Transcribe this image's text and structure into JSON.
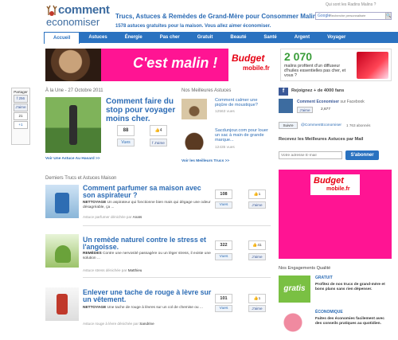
{
  "header": {
    "logo_line1": "comment",
    "logo_line2": "economiser",
    "tagline": "Trucs, Astuces & Remèdes de Grand-Mère pour Consommer Malin.",
    "subtagline": "1578 astuces gratuites pour la maison. Vous allez aimer économiser.",
    "top_link": "Qui sont les Radins Malins ?",
    "search_brand": "Google",
    "search_placeholder": "Recherche personnalisée",
    "search_button": "🔍"
  },
  "nav": {
    "items": [
      "Accueil",
      "Astuces",
      "Énergie",
      "Pas cher",
      "Gratuit",
      "Beauté",
      "Santé",
      "Argent",
      "Voyager"
    ]
  },
  "banner": {
    "slogan": "C'est malin !",
    "brand1": "Budget",
    "brand2": "mobile.fr"
  },
  "ad_right": {
    "number": "2 070",
    "text": "malins profitent d'un diffuseur d'huiles essentielles pas cher, et vous ?"
  },
  "share": {
    "label": "Partager",
    "fb_count": "256",
    "fb_label": "J'aime",
    "count2": "21",
    "plus": "+1"
  },
  "une": {
    "heading": "À la Une - 27 Octobre 2011",
    "title": "Comment faire du stop pour voyager moins cher.",
    "count": "88",
    "vues": "Vues",
    "like": "4",
    "like_fb": "J'aime",
    "random_link": "Voir Une Astuce Au Hasard >>"
  },
  "best": {
    "heading": "Nos Meilleures Astuces",
    "items": [
      {
        "title": "Comment calmer une piqûre de moustique?",
        "views": "12563 vues"
      },
      {
        "title": "Sacdunjour.com pour louer un sac à main de grande marque...",
        "views": "12435 vues"
      }
    ],
    "link": "Voir les Meilleurs Trucs >>"
  },
  "derniers": {
    "heading": "Derniers Trucs et Astuces Maison",
    "articles": [
      {
        "title": "Comment parfumer sa maison avec son aspirateur ?",
        "desc_prefix": "NETTOYAGE",
        "desc": "Un aspirateur qui fonctionne bien mais qui dégage une odeur désagréable, ça ...",
        "author_prefix": "Astuce parfumer dénichée par",
        "author": "Anaïs",
        "count": "108",
        "likes": "1"
      },
      {
        "title": "Un remède naturel contre le stress et l'angoisse.",
        "desc_prefix": "REMÈDES",
        "desc": "Contre une nervosité passagère ou un léger stress, il existe une solution ...",
        "author_prefix": "Astuce stress dénichée par",
        "author": "Matthieu",
        "count": "322",
        "likes": "41"
      },
      {
        "title": "Enlever une tache de rouge à lèvre sur un vêtement.",
        "desc_prefix": "NETTOYAGE",
        "desc": "Une tache de rouge à lèvres sur un col de chemise ou ...",
        "author_prefix": "Astuce rouge à lèvre dénichée par",
        "author": "Sandrine",
        "count": "101",
        "likes": "1"
      }
    ],
    "vues": "Vues",
    "like_fb": "J'aime"
  },
  "right": {
    "fb_heading": "Rejoignez + de 4000 fans",
    "fb_name": "Comment Economiser",
    "fb_on": "sur Facebook",
    "fb_like": "J'aime",
    "fb_count": "2,677",
    "tw_follow": "Suivre",
    "tw_handle": "@CommentEconomiser",
    "tw_count": "1 763 abonnés",
    "newsletter_heading": "Recevez les Meilleures Astuces par Mail",
    "newsletter_placeholder": "Votre adresse E-mail",
    "newsletter_button": "S'abonner",
    "ad_brand1": "Budget",
    "ad_brand2": "mobile.fr",
    "engage_heading": "Nos Engagements Qualité",
    "engagements": [
      {
        "title": "GRATUIT",
        "desc": "Profitez de nos trucs de grand-mère et bons plans sans rien dépenser.",
        "img_text": "gratis"
      },
      {
        "title": "ÉCONOMIQUE",
        "desc": "Faites des économies facilement avec des conseils pratiques au quotidien.",
        "img_text": ""
      }
    ]
  },
  "colors": {
    "brand": "#2a72c0",
    "ad_pink": "#ff1493",
    "fb": "#3b5998"
  }
}
